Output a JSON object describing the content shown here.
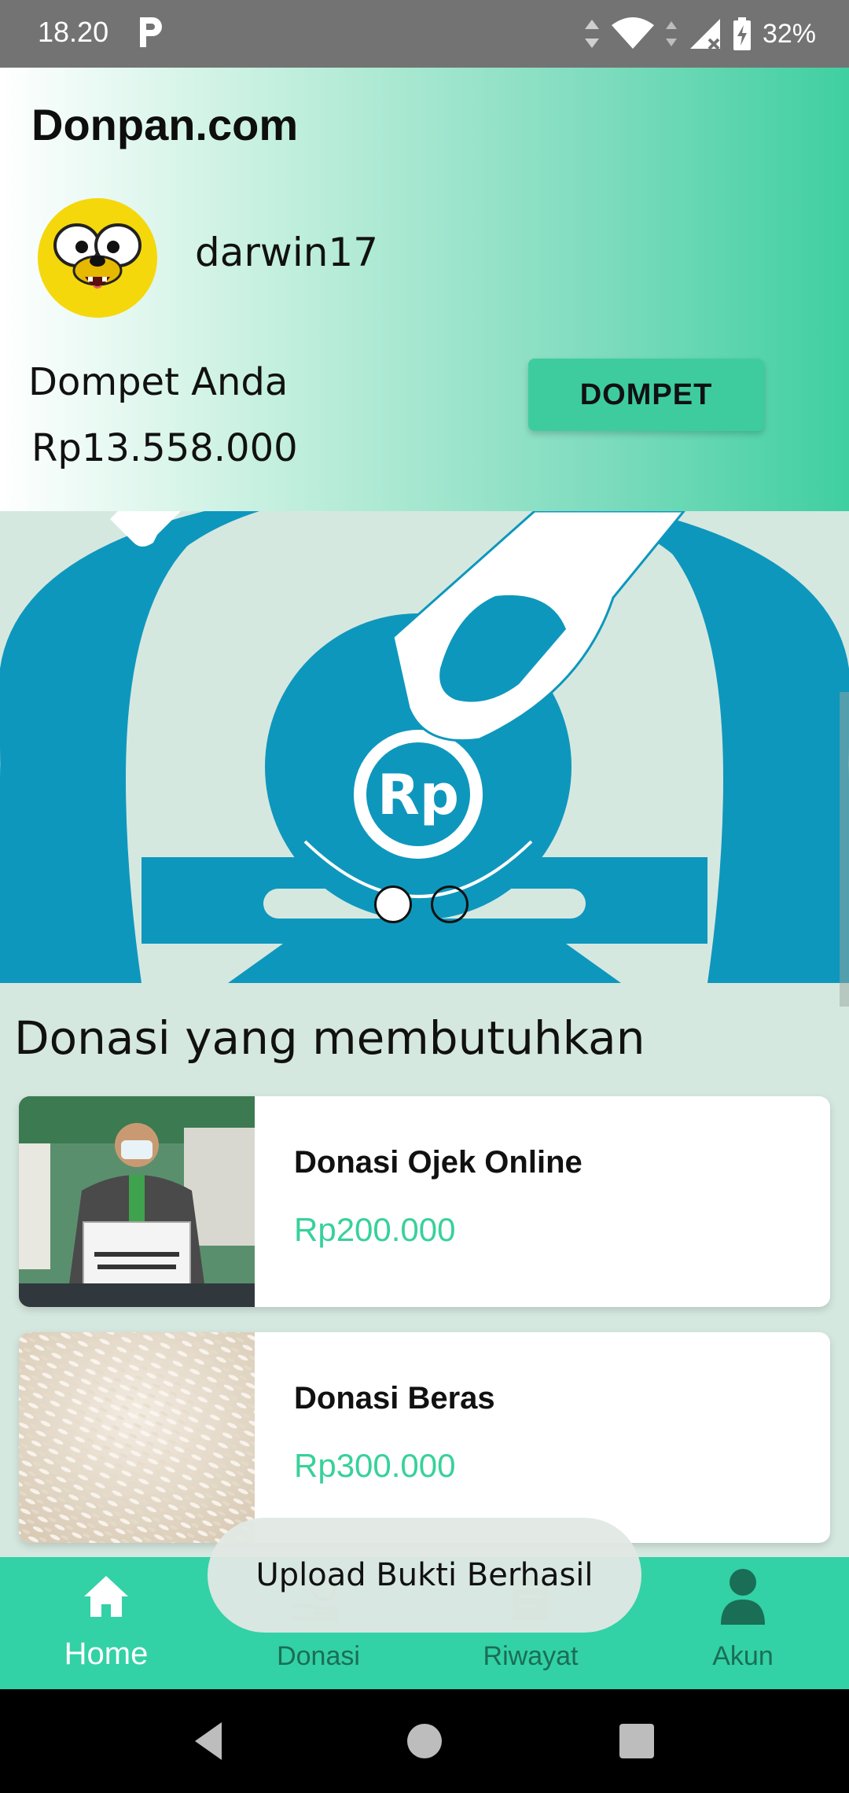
{
  "status_bar": {
    "time": "18.20",
    "battery": "32%",
    "icons": [
      "p-app-icon",
      "data-arrows-icon",
      "wifi-icon",
      "signal-icon",
      "battery-icon"
    ]
  },
  "header": {
    "app_title": "Donpan.com",
    "username": "darwin17",
    "avatar_icon": "jake-the-dog-avatar",
    "wallet_label": "Dompet Anda",
    "wallet_amount": "Rp13.558.000",
    "wallet_button": "DOMPET"
  },
  "banner": {
    "badge_text": "Rp",
    "slides": 2,
    "active_slide": 1,
    "colors": {
      "primary": "#0e97bd",
      "background": "#d5e8e0"
    }
  },
  "section": {
    "title": "Donasi yang membutuhkan"
  },
  "donations": [
    {
      "title": "Donasi Ojek Online",
      "amount": "Rp200.000"
    },
    {
      "title": "Donasi Beras",
      "amount": "Rp300.000"
    }
  ],
  "bottom_nav": {
    "items": [
      {
        "label": "Home",
        "icon": "home-icon",
        "active": true
      },
      {
        "label": "Donasi",
        "icon": "donate-icon",
        "active": false
      },
      {
        "label": "Riwayat",
        "icon": "history-icon",
        "active": false
      },
      {
        "label": "Akun",
        "icon": "account-icon",
        "active": false
      }
    ]
  },
  "toast": {
    "message": "Upload Bukti Berhasil"
  },
  "theme": {
    "accent": "#33d1a6",
    "price_color": "#38d19b"
  }
}
